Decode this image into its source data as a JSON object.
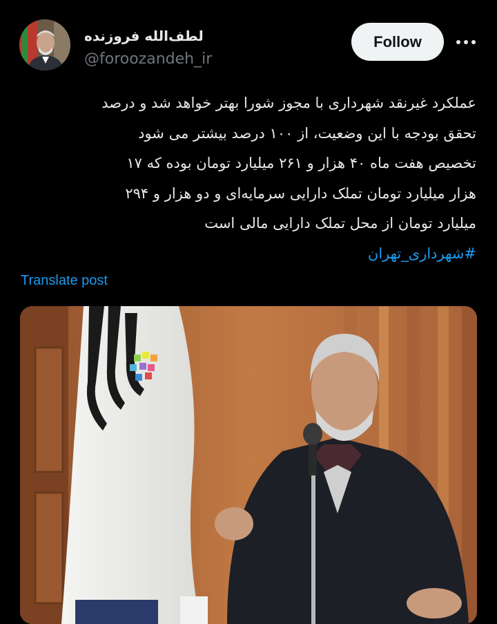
{
  "author": {
    "display_name": "لطف‌الله فروزنده",
    "handle": "@foroozandeh_ir",
    "avatar_icon": "avatar-photo"
  },
  "actions": {
    "follow_label": "Follow",
    "more_icon": "more-horizontal-icon"
  },
  "post": {
    "lines": [
      "عملکرد غیرنقد شهرداری با مجوز شورا بهتر خواهد شد و درصد",
      "تحقق بودجه با این وضعیت، از ۱۰۰ درصد بیشتر می شود",
      "تخصیص هفت ماه ۴۰ هزار و ۲۶۱ میلیارد تومان بوده که ۱۷",
      "هزار میلیارد تومان تملک دارایی سرمایه‌ای و دو هزار و ۲۹۴",
      "میلیارد تومان از محل تملک دارایی مالی است"
    ],
    "hashtag": "#شهرداری_تهران",
    "translate_label": "Translate post"
  },
  "media": {
    "description_icon": "post-photo"
  },
  "colors": {
    "background": "#000000",
    "text": "#e7e9ea",
    "muted": "#71767b",
    "link": "#1d9bf0",
    "follow_bg": "#eff3f4"
  }
}
